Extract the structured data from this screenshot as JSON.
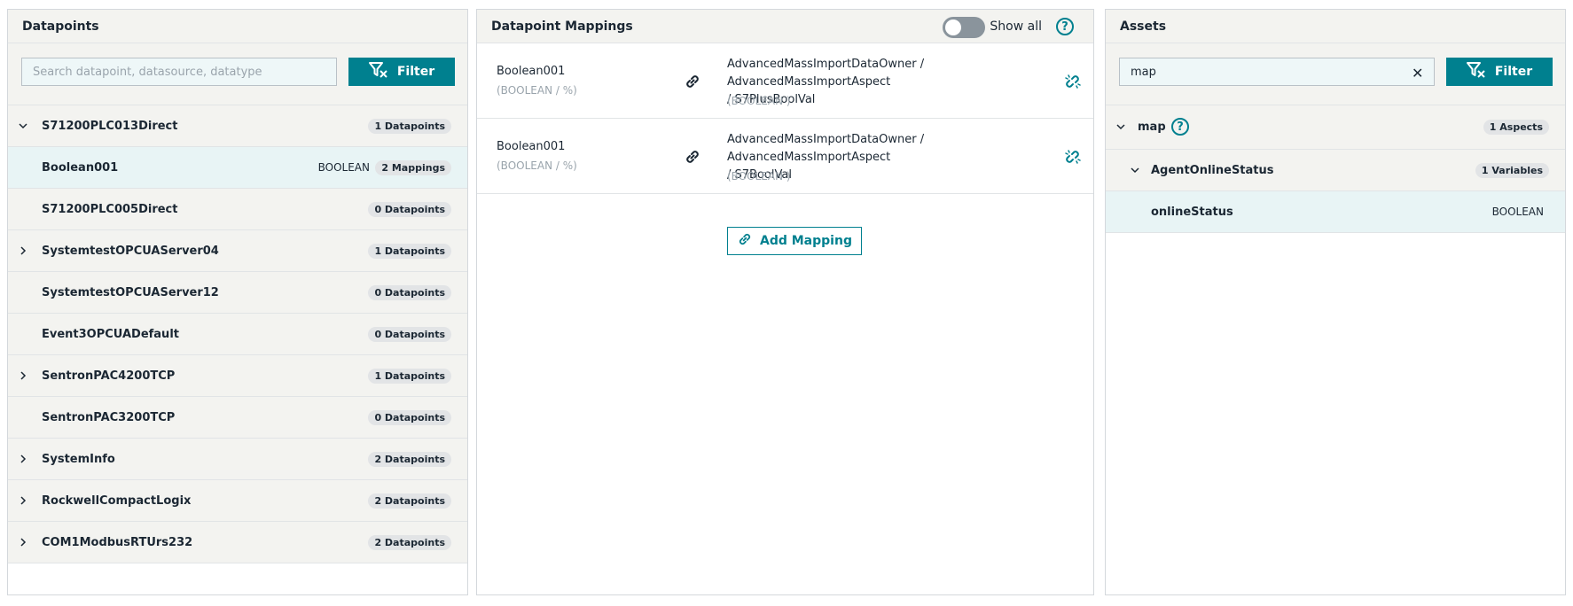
{
  "datapoints": {
    "title": "Datapoints",
    "search_placeholder": "Search datapoint, datasource, datatype",
    "filter_label": "Filter",
    "rows": [
      {
        "name": "S71200PLC013Direct",
        "badge": "1 Datapoints",
        "expanded": true
      },
      {
        "name": "Boolean001",
        "type": "BOOLEAN",
        "badge": "2 Mappings",
        "child": true
      },
      {
        "name": "S71200PLC005Direct",
        "badge": "0 Datapoints"
      },
      {
        "name": "SystemtestOPCUAServer04",
        "badge": "1 Datapoints",
        "collapsed": true
      },
      {
        "name": "SystemtestOPCUAServer12",
        "badge": "0 Datapoints"
      },
      {
        "name": "Event3OPCUADefault",
        "badge": "0 Datapoints"
      },
      {
        "name": "SentronPAC4200TCP",
        "badge": "1 Datapoints",
        "collapsed": true
      },
      {
        "name": "SentronPAC3200TCP",
        "badge": "0 Datapoints"
      },
      {
        "name": "SystemInfo",
        "badge": "2 Datapoints",
        "collapsed": true
      },
      {
        "name": "RockwellCompactLogix",
        "badge": "2 Datapoints",
        "collapsed": true
      },
      {
        "name": "COM1ModbusRTUrs232",
        "badge": "2 Datapoints",
        "collapsed": true
      }
    ]
  },
  "mappings": {
    "title": "Datapoint Mappings",
    "show_all_label": "Show all",
    "toggle_on": false,
    "add_mapping_label": "Add Mapping",
    "items": [
      {
        "datapoint": "Boolean001",
        "datapoint_type": "(BOOLEAN / %)",
        "asset_path_line1": "AdvancedMassImportDataOwner / AdvancedMassImportAspect",
        "asset_path_line2": "/ S7PlusBoolVal",
        "asset_type": "(BOOLEAN )"
      },
      {
        "datapoint": "Boolean001",
        "datapoint_type": "(BOOLEAN / %)",
        "asset_path_line1": "AdvancedMassImportDataOwner / AdvancedMassImportAspect",
        "asset_path_line2": "/ S7BoolVal",
        "asset_type": "(BOOLEAN )"
      }
    ]
  },
  "assets": {
    "title": "Assets",
    "search_value": "map",
    "filter_label": "Filter",
    "tree": {
      "root_name": "map",
      "root_badge": "1 Aspects",
      "aspect_name": "AgentOnlineStatus",
      "aspect_badge": "1 Variables",
      "variable_name": "onlineStatus",
      "variable_type": "BOOLEAN"
    }
  },
  "colors": {
    "accent": "#00808f",
    "panel_bg": "#f3f3f0",
    "selected_bg": "#e8f4f5"
  }
}
